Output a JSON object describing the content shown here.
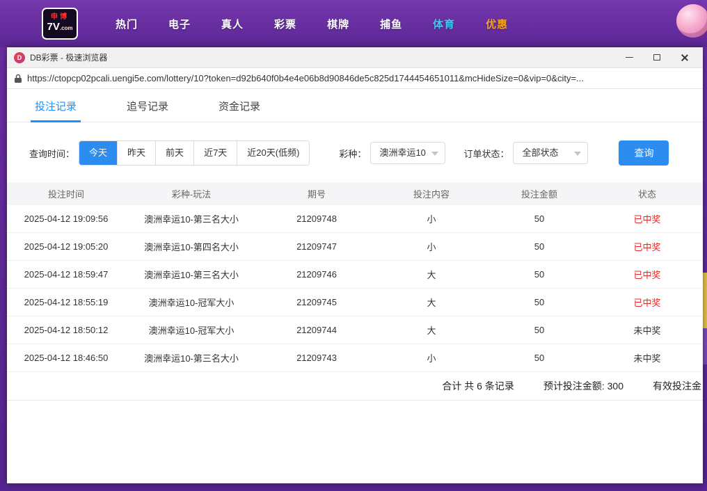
{
  "colors": {
    "topbar_purple": "#6b2fa3",
    "accent_blue": "#2d8cf0",
    "tab_active_blue": "#1890ff",
    "win_red": "#e02b2b",
    "nav_sports_cyan": "#3fc9f2",
    "nav_promo_orange": "#f6a41f"
  },
  "topbar": {
    "logo": {
      "top": "申博",
      "main": "7V",
      "suffix": ".com"
    },
    "nav_items": [
      {
        "label": "热门"
      },
      {
        "label": "电子"
      },
      {
        "label": "真人"
      },
      {
        "label": "彩票"
      },
      {
        "label": "棋牌"
      },
      {
        "label": "捕鱼"
      },
      {
        "label": "体育"
      },
      {
        "label": "优惠"
      }
    ]
  },
  "browser": {
    "favicon": "D",
    "title": "DB彩票 - 极速浏览器",
    "url": "https://ctopcp02pcali.uengi5e.com/lottery/10?token=d92b640f0b4e4e06b8d90846de5c825d1744454651011&mcHideSize=0&vip=0&city=..."
  },
  "tabs": [
    {
      "label": "投注记录"
    },
    {
      "label": "追号记录"
    },
    {
      "label": "资金记录"
    }
  ],
  "filters": {
    "time_label": "查询时间：",
    "time_options": [
      {
        "label": "今天"
      },
      {
        "label": "昨天"
      },
      {
        "label": "前天"
      },
      {
        "label": "近7天"
      },
      {
        "label": "近20天(低频)"
      }
    ],
    "lottery_label": "彩种：",
    "lottery_value": "澳洲幸运10",
    "status_label": "订单状态：",
    "status_value": "全部状态",
    "query_button": "查询"
  },
  "table": {
    "headers": [
      "投注时间",
      "彩种-玩法",
      "期号",
      "投注内容",
      "投注金额",
      "状态"
    ],
    "rows": [
      {
        "time": "2025-04-12 19:09:56",
        "play": "澳洲幸运10-第三名大小",
        "issue": "21209748",
        "content": "小",
        "amount": "50",
        "status": "已中奖",
        "won": true
      },
      {
        "time": "2025-04-12 19:05:20",
        "play": "澳洲幸运10-第四名大小",
        "issue": "21209747",
        "content": "小",
        "amount": "50",
        "status": "已中奖",
        "won": true
      },
      {
        "time": "2025-04-12 18:59:47",
        "play": "澳洲幸运10-第三名大小",
        "issue": "21209746",
        "content": "大",
        "amount": "50",
        "status": "已中奖",
        "won": true
      },
      {
        "time": "2025-04-12 18:55:19",
        "play": "澳洲幸运10-冠军大小",
        "issue": "21209745",
        "content": "大",
        "amount": "50",
        "status": "已中奖",
        "won": true
      },
      {
        "time": "2025-04-12 18:50:12",
        "play": "澳洲幸运10-冠军大小",
        "issue": "21209744",
        "content": "大",
        "amount": "50",
        "status": "未中奖",
        "won": false
      },
      {
        "time": "2025-04-12 18:46:50",
        "play": "澳洲幸运10-第三名大小",
        "issue": "21209743",
        "content": "小",
        "amount": "50",
        "status": "未中奖",
        "won": false
      }
    ]
  },
  "summary": {
    "total": "合计 共 6 条记录",
    "expected": "预计投注金额: 300",
    "valid": "有效投注金"
  }
}
